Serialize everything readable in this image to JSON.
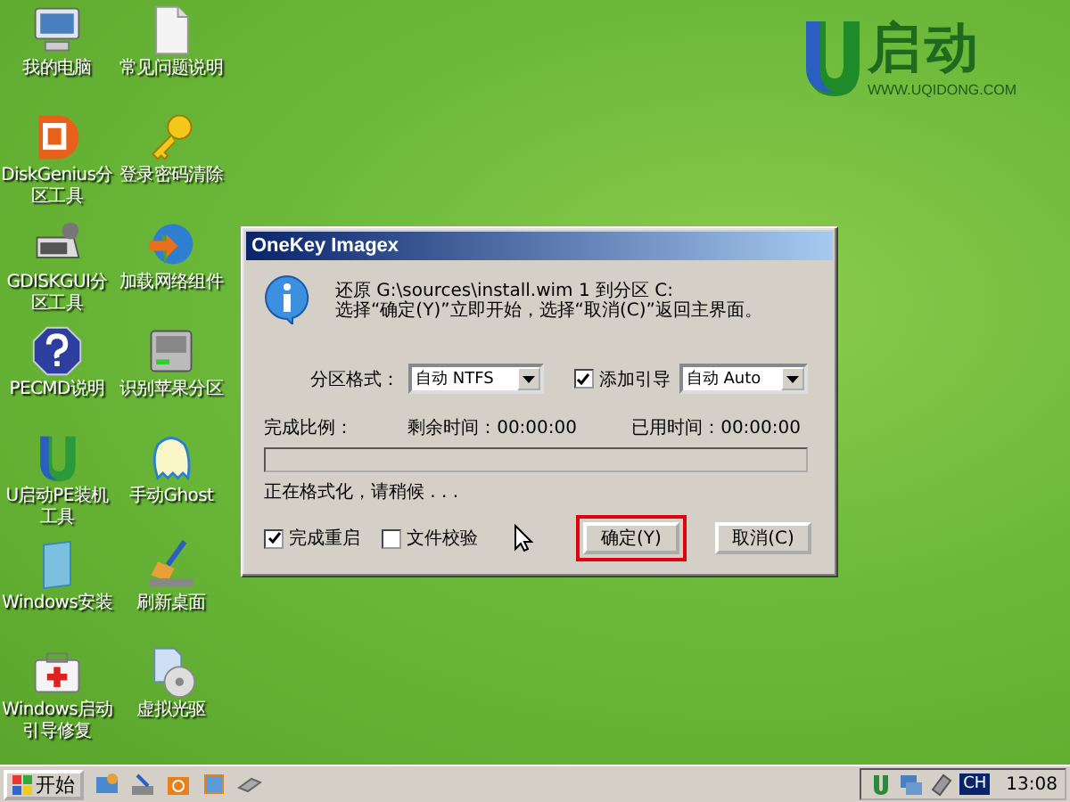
{
  "desktop_icons": [
    {
      "label": "我的电脑",
      "kind": "computer"
    },
    {
      "label": "常见问题说明",
      "kind": "document"
    },
    {
      "label": "DiskGenius分区工具",
      "kind": "partition"
    },
    {
      "label": "登录密码清除",
      "kind": "key"
    },
    {
      "label": "GDISKGUI分区工具",
      "kind": "disk"
    },
    {
      "label": "加载网络组件",
      "kind": "globe"
    },
    {
      "label": "PECMD说明",
      "kind": "help"
    },
    {
      "label": "识别苹果分区",
      "kind": "drive"
    },
    {
      "label": "U启动PE装机工具",
      "kind": "logo"
    },
    {
      "label": "手动Ghost",
      "kind": "ghost"
    },
    {
      "label": "Windows安装",
      "kind": "install"
    },
    {
      "label": "刷新桌面",
      "kind": "broom"
    },
    {
      "label": "Windows启动引导修复",
      "kind": "aid"
    },
    {
      "label": "虚拟光驱",
      "kind": "cd"
    }
  ],
  "logo": {
    "brand": "启动",
    "url": "WWW.UQIDONG.COM"
  },
  "dialog": {
    "title": "OneKey Imagex",
    "message_lines": [
      "还原 G:\\sources\\install.wim 1 到分区 C:",
      "选择“确定(Y)”立即开始，选择“取消(C)”返回主界面。"
    ],
    "format_label": "分区格式：",
    "format_value": "自动 NTFS",
    "add_boot": {
      "label": "添加引导",
      "checked": true
    },
    "boot_value": "自动 Auto",
    "progress_label": "完成比例：",
    "remaining": "剩余时间：00:00:00",
    "elapsed": "已用时间：00:00:00",
    "progress": {
      "level": 0
    },
    "status": "正在格式化，请稍候 . . .",
    "restart": {
      "label": "完成重启",
      "checked": true
    },
    "verify": {
      "label": "文件校验",
      "checked": false
    },
    "buttons": [
      {
        "label": "确定(Y)",
        "highlighted": true
      },
      {
        "label": "取消(C)",
        "highlighted": false
      }
    ]
  },
  "taskbar": {
    "start": "开始",
    "input_indicator": "CH",
    "clock": "13:08"
  }
}
